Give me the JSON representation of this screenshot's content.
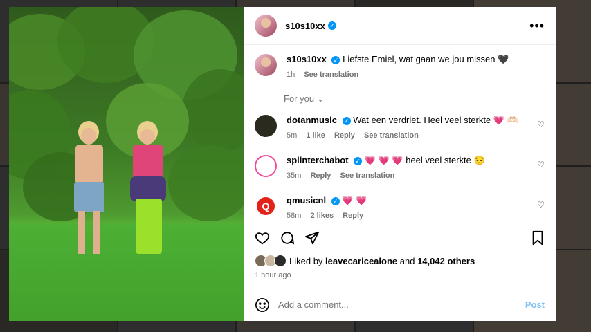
{
  "post": {
    "author": "s10s10xx",
    "caption": "Liefste Emiel, wat gaan we jou missen 🖤",
    "caption_time": "1h",
    "see_translation": "See translation"
  },
  "for_you": "For you",
  "comments": [
    {
      "user": "dotanmusic",
      "text": "Wat een verdriet. Heel veel sterkte 💗 🫶🏻",
      "time": "5m",
      "likes": "1 like",
      "reply": "Reply",
      "translate": "See translation"
    },
    {
      "user": "splinterchabot",
      "text": "💗 💗 💗 heel veel sterkte 😔",
      "time": "35m",
      "reply": "Reply",
      "translate": "See translation"
    },
    {
      "user": "qmusicnl",
      "text": "💗 💗",
      "time": "58m",
      "likes": "2 likes",
      "reply": "Reply"
    }
  ],
  "likes_line": {
    "prefix": "Liked by",
    "user": "leavecaricealone",
    "middle": "and",
    "count": "14,042 others"
  },
  "posted": "1 hour ago",
  "add_comment": {
    "placeholder": "Add a comment...",
    "post": "Post"
  },
  "icons": {
    "more": "more-options-icon",
    "like": "heart-icon",
    "comment": "comment-icon",
    "share": "share-icon",
    "save": "bookmark-icon",
    "emoji": "emoji-icon"
  },
  "colors": {
    "verified": "#0095f6",
    "post_button": "#84c4f5",
    "muted_text": "#737373"
  }
}
